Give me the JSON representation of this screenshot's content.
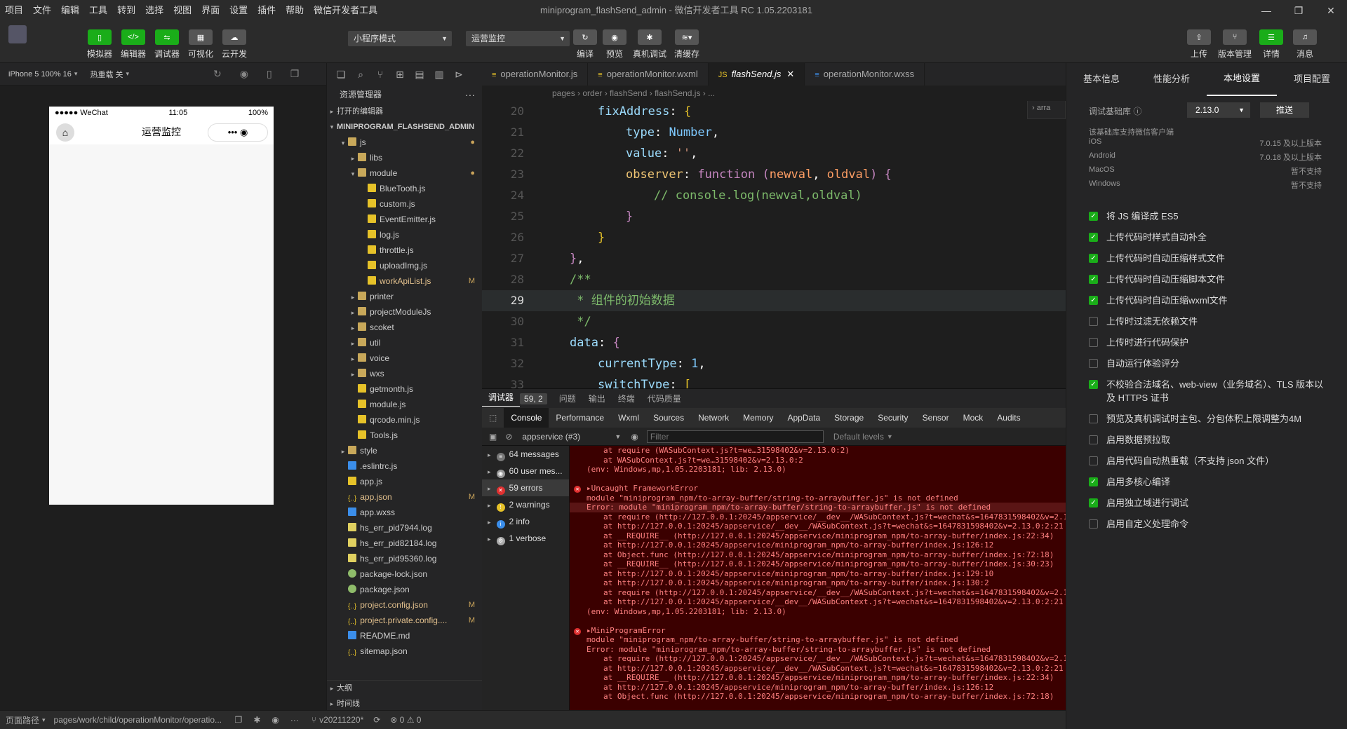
{
  "menu": [
    "项目",
    "文件",
    "编辑",
    "工具",
    "转到",
    "选择",
    "视图",
    "界面",
    "设置",
    "插件",
    "帮助",
    "微信开发者工具"
  ],
  "window_title": "miniprogram_flashSend_admin - 微信开发者工具 RC 1.05.2203181",
  "toolbar": {
    "simulator": "模拟器",
    "editor": "编辑器",
    "debugger": "调试器",
    "visual": "可视化",
    "cloud": "云开发",
    "mode_select": "小程序模式",
    "compile_select": "运营监控",
    "compile": "编译",
    "preview": "预览",
    "real_debug": "真机调试",
    "clear_cache": "清缓存",
    "upload": "上传",
    "version": "版本管理",
    "details": "详情",
    "messages": "消息"
  },
  "sim_bar": {
    "device": "iPhone 5 100% 16",
    "hotreload": "热重载 关"
  },
  "phone": {
    "carrier": "●●●●● WeChat",
    "time": "11:05",
    "battery": "100%",
    "title": "运营监控"
  },
  "explorer": {
    "title": "资源管理器",
    "open_editors": "打开的编辑器",
    "project": "MINIPROGRAM_FLASHSEND_ADMIN",
    "tree": [
      {
        "name": "js",
        "kind": "folder",
        "depth": 1,
        "open": true,
        "dot": true
      },
      {
        "name": "libs",
        "kind": "folder",
        "depth": 2,
        "open": false
      },
      {
        "name": "module",
        "kind": "folder",
        "depth": 2,
        "open": true,
        "dot": true
      },
      {
        "name": "BlueTooth.js",
        "kind": "js",
        "depth": 3
      },
      {
        "name": "custom.js",
        "kind": "js",
        "depth": 3
      },
      {
        "name": "EventEmitter.js",
        "kind": "js",
        "depth": 3
      },
      {
        "name": "log.js",
        "kind": "js",
        "depth": 3
      },
      {
        "name": "throttle.js",
        "kind": "js",
        "depth": 3
      },
      {
        "name": "uploadImg.js",
        "kind": "js",
        "depth": 3
      },
      {
        "name": "workApiList.js",
        "kind": "js",
        "depth": 3,
        "badge": "M",
        "mod": true
      },
      {
        "name": "printer",
        "kind": "folder",
        "depth": 2,
        "open": false
      },
      {
        "name": "projectModuleJs",
        "kind": "folder",
        "depth": 2,
        "open": false
      },
      {
        "name": "scoket",
        "kind": "folder",
        "depth": 2,
        "open": false
      },
      {
        "name": "util",
        "kind": "folder",
        "depth": 2,
        "open": false
      },
      {
        "name": "voice",
        "kind": "folder",
        "depth": 2,
        "open": false
      },
      {
        "name": "wxs",
        "kind": "folder",
        "depth": 2,
        "open": false
      },
      {
        "name": "getmonth.js",
        "kind": "js",
        "depth": 2
      },
      {
        "name": "module.js",
        "kind": "js",
        "depth": 2
      },
      {
        "name": "qrcode.min.js",
        "kind": "js",
        "depth": 2
      },
      {
        "name": "Tools.js",
        "kind": "js",
        "depth": 2
      },
      {
        "name": "style",
        "kind": "folder",
        "depth": 1,
        "open": false
      },
      {
        "name": ".eslintrc.js",
        "kind": "eslint",
        "depth": 1
      },
      {
        "name": "app.js",
        "kind": "js",
        "depth": 1
      },
      {
        "name": "app.json",
        "kind": "json",
        "depth": 1,
        "badge": "M",
        "mod": true
      },
      {
        "name": "app.wxss",
        "kind": "wxss",
        "depth": 1
      },
      {
        "name": "hs_err_pid7944.log",
        "kind": "log",
        "depth": 1
      },
      {
        "name": "hs_err_pid82184.log",
        "kind": "log",
        "depth": 1
      },
      {
        "name": "hs_err_pid95360.log",
        "kind": "log",
        "depth": 1
      },
      {
        "name": "package-lock.json",
        "kind": "pkg",
        "depth": 1
      },
      {
        "name": "package.json",
        "kind": "pkg",
        "depth": 1
      },
      {
        "name": "project.config.json",
        "kind": "json",
        "depth": 1,
        "badge": "M",
        "mod": true
      },
      {
        "name": "project.private.config....",
        "kind": "json",
        "depth": 1,
        "badge": "M",
        "mod": true
      },
      {
        "name": "README.md",
        "kind": "info",
        "depth": 1
      },
      {
        "name": "sitemap.json",
        "kind": "json",
        "depth": 1
      }
    ],
    "outline": "大纲",
    "timeline": "时间线"
  },
  "editor_tabs": [
    "operationMonitor.js",
    "operationMonitor.wxml",
    "flashSend.js",
    "operationMonitor.wxss"
  ],
  "breadcrumb": "pages › order › flashSend › flashSend.js › ...",
  "code_lines": [
    {
      "n": "20",
      "html": "<span class='pr'>fixAddress</span><span class='p'>: </span><span class='gb'>{</span>",
      "indent": 1
    },
    {
      "n": "21",
      "html": "<span class='pr'>type</span><span class='p'>: </span><span class='t'>Number</span><span class='p'>,</span>",
      "indent": 2
    },
    {
      "n": "22",
      "html": "<span class='pr'>value</span><span class='p'>: </span><span class='s'>''</span><span class='p'>,</span>",
      "indent": 2
    },
    {
      "n": "23",
      "html": "<span class='kw'>observer</span><span class='p'>: </span><span class='pk'>function</span><span class='p'> </span><span class='pk'>(</span><span class='or'>newval</span><span class='p'>, </span><span class='or'>oldval</span><span class='pk'>)</span><span class='p'> </span><span class='pk'>{</span>",
      "indent": 2
    },
    {
      "n": "24",
      "html": "<span class='cm'>// console.log(newval,oldval)</span>",
      "indent": 3
    },
    {
      "n": "25",
      "html": "<span class='pk'>}</span>",
      "indent": 2
    },
    {
      "n": "26",
      "html": "<span class='gb'>}</span>",
      "indent": 1
    },
    {
      "n": "27",
      "html": "<span class='pk'>}</span><span class='p'>,</span>",
      "indent": 0
    },
    {
      "n": "28",
      "html": "<span class='cm'>/**</span>",
      "indent": 0
    },
    {
      "n": "29",
      "html": "<span class='cm'> * 组件的初始数据</span>",
      "indent": 0,
      "hl": true
    },
    {
      "n": "30",
      "html": "<span class='cm'> */</span>",
      "indent": 0
    },
    {
      "n": "31",
      "html": "<span class='pr'>data</span><span class='p'>: </span><span class='pk'>{</span>",
      "indent": 0
    },
    {
      "n": "32",
      "html": "<span class='pr'>currentType</span><span class='p'>: </span><span class='t'>1</span><span class='p'>,</span>",
      "indent": 1
    },
    {
      "n": "33",
      "html": "<span class='pr'>switchType</span><span class='p'>: </span><span class='gb'>[</span>",
      "indent": 1
    }
  ],
  "devtools_top": [
    "调试器",
    "59, 2",
    "问题",
    "输出",
    "终端",
    "代码质量"
  ],
  "devtools_tabs": [
    "Console",
    "Performance",
    "Wxml",
    "Sources",
    "Network",
    "Memory",
    "AppData",
    "Storage",
    "Security",
    "Sensor",
    "Mock",
    "Audits"
  ],
  "filter": {
    "context": "appservice (#3)",
    "placeholder": "Filter",
    "levels": "Default levels"
  },
  "console_side": [
    {
      "label": "64 messages"
    },
    {
      "label": "60 user mes..."
    },
    {
      "label": "59 errors",
      "active": true
    },
    {
      "label": "2 warnings"
    },
    {
      "label": "2 info"
    },
    {
      "label": "1 verbose"
    }
  ],
  "console_lines": [
    {
      "t": "at require (WASubContext.js?t=we…31598402&v=2.13.0:2)",
      "c": "i1"
    },
    {
      "t": "at WASubContext.js?t=we…31598402&v=2.13.0:2",
      "c": "i1"
    },
    {
      "t": "(env: Windows,mp,1.05.2203181; lib: 2.13.0)",
      "c": ""
    },
    {
      "t": "",
      "c": ""
    },
    {
      "t": "▸Uncaught FrameworkError",
      "c": "",
      "x": true
    },
    {
      "t": "module \"miniprogram_npm/to-array-buffer/string-to-arraybuffer.js\" is not defined",
      "c": ""
    },
    {
      "t": "Error: module \"miniprogram_npm/to-array-buffer/string-to-arraybuffer.js\" is not defined",
      "c": "hi"
    },
    {
      "t": "at require (http://127.0.0.1:20245/appservice/__dev__/WASubContext.js?t=wechat&s=1647831598402&v=2.1",
      "c": "i1"
    },
    {
      "t": "at http://127.0.0.1:20245/appservice/__dev__/WASubContext.js?t=wechat&s=1647831598402&v=2.13.0:2:21",
      "c": "i1"
    },
    {
      "t": "at __REQUIRE__ (http://127.0.0.1:20245/appservice/miniprogram_npm/to-array-buffer/index.js:22:34)",
      "c": "i1"
    },
    {
      "t": "at http://127.0.0.1:20245/appservice/miniprogram_npm/to-array-buffer/index.js:126:12",
      "c": "i1"
    },
    {
      "t": "at Object.func (http://127.0.0.1:20245/appservice/miniprogram_npm/to-array-buffer/index.js:72:18)",
      "c": "i1"
    },
    {
      "t": "at __REQUIRE__ (http://127.0.0.1:20245/appservice/miniprogram_npm/to-array-buffer/index.js:30:23)",
      "c": "i1"
    },
    {
      "t": "at http://127.0.0.1:20245/appservice/miniprogram_npm/to-array-buffer/index.js:129:10",
      "c": "i1"
    },
    {
      "t": "at http://127.0.0.1:20245/appservice/miniprogram_npm/to-array-buffer/index.js:130:2",
      "c": "i1"
    },
    {
      "t": "at require (http://127.0.0.1:20245/appservice/__dev__/WASubContext.js?t=wechat&s=1647831598402&v=2.1",
      "c": "i1"
    },
    {
      "t": "at http://127.0.0.1:20245/appservice/__dev__/WASubContext.js?t=wechat&s=1647831598402&v=2.13.0:2:21",
      "c": "i1"
    },
    {
      "t": "(env: Windows,mp,1.05.2203181; lib: 2.13.0)",
      "c": ""
    },
    {
      "t": "",
      "c": ""
    },
    {
      "t": "▸MiniProgramError",
      "c": "",
      "x": true
    },
    {
      "t": "module \"miniprogram_npm/to-array-buffer/string-to-arraybuffer.js\" is not defined",
      "c": ""
    },
    {
      "t": "Error: module \"miniprogram_npm/to-array-buffer/string-to-arraybuffer.js\" is not defined",
      "c": ""
    },
    {
      "t": "at require (http://127.0.0.1:20245/appservice/__dev__/WASubContext.js?t=wechat&s=1647831598402&v=2.1",
      "c": "i1"
    },
    {
      "t": "at http://127.0.0.1:20245/appservice/__dev__/WASubContext.js?t=wechat&s=1647831598402&v=2.13.0:2:21",
      "c": "i1"
    },
    {
      "t": "at __REQUIRE__ (http://127.0.0.1:20245/appservice/miniprogram_npm/to-array-buffer/index.js:22:34)",
      "c": "i1"
    },
    {
      "t": "at http://127.0.0.1:20245/appservice/miniprogram_npm/to-array-buffer/index.js:126:12",
      "c": "i1"
    },
    {
      "t": "at Object.func (http://127.0.0.1:20245/appservice/miniprogram_npm/to-array-buffer/index.js:72:18)",
      "c": "i1"
    }
  ],
  "right_panel": {
    "tabs": [
      "基本信息",
      "性能分析",
      "本地设置",
      "项目配置"
    ],
    "lib_label": "调试基础库",
    "lib_version": "2.13.0",
    "push": "推送",
    "support_title": "该基础库支持微信客户端",
    "support": [
      {
        "os": "iOS",
        "v": "7.0.15 及以上版本"
      },
      {
        "os": "Android",
        "v": "7.0.18 及以上版本"
      },
      {
        "os": "MacOS",
        "v": "暂不支持"
      },
      {
        "os": "Windows",
        "v": "暂不支持"
      }
    ],
    "options": [
      {
        "label": "将 JS 编译成 ES5",
        "on": true
      },
      {
        "label": "上传代码时样式自动补全",
        "on": true
      },
      {
        "label": "上传代码时自动压缩样式文件",
        "on": true
      },
      {
        "label": "上传代码时自动压缩脚本文件",
        "on": true
      },
      {
        "label": "上传代码时自动压缩wxml文件",
        "on": true
      },
      {
        "label": "上传时过滤无依赖文件",
        "on": false
      },
      {
        "label": "上传时进行代码保护",
        "on": false
      },
      {
        "label": "自动运行体验评分",
        "on": false
      },
      {
        "label": "不校验合法域名、web-view（业务域名）、TLS 版本以及 HTTPS 证书",
        "on": true
      },
      {
        "label": "预览及真机调试时主包、分包体积上限调整为4M",
        "on": false
      },
      {
        "label": "启用数据预拉取",
        "on": false
      },
      {
        "label": "启用代码自动热重载（不支持 json 文件）",
        "on": false
      },
      {
        "label": "启用多核心编译",
        "on": true
      },
      {
        "label": "启用独立域进行调试",
        "on": true
      },
      {
        "label": "启用自定义处理命令",
        "on": false
      }
    ]
  },
  "status": {
    "path_label": "页面路径",
    "path": "pages/work/child/operationMonitor/operatio...",
    "branch": "v20211220*",
    "problems": "⊗ 0 ⚠ 0"
  },
  "colors": {
    "accent": "#1aad19",
    "error_bg": "#3b0000"
  }
}
